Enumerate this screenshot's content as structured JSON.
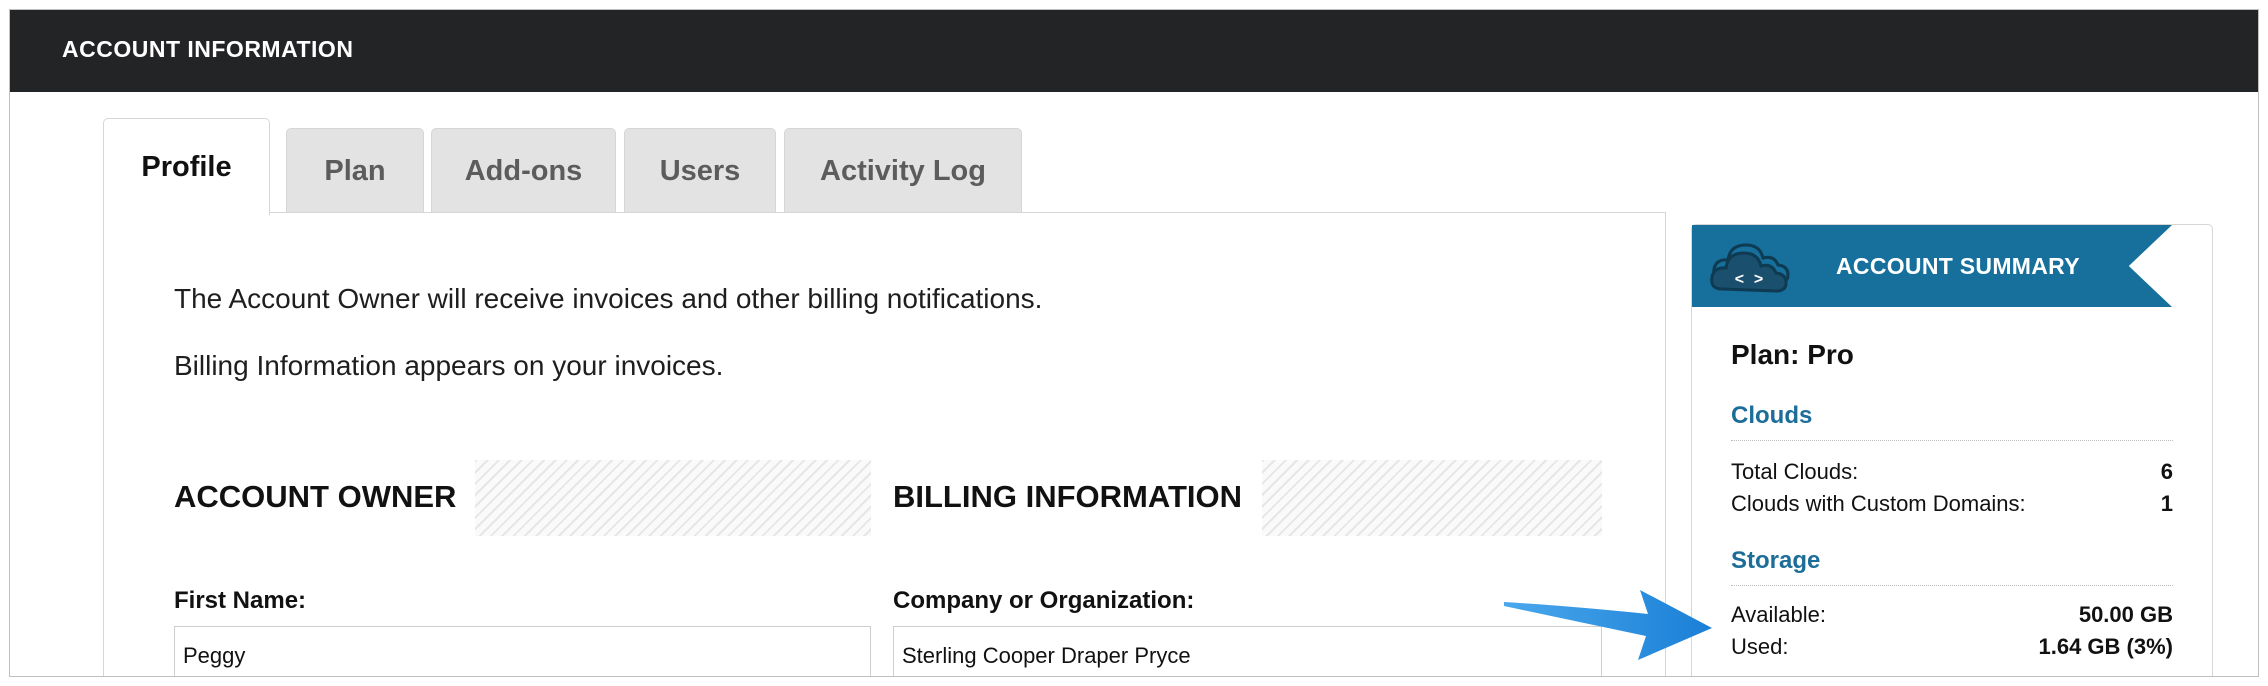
{
  "header": {
    "title": "ACCOUNT INFORMATION"
  },
  "tabs": [
    {
      "label": "Profile",
      "active": true
    },
    {
      "label": "Plan"
    },
    {
      "label": "Add-ons"
    },
    {
      "label": "Users"
    },
    {
      "label": "Activity Log"
    }
  ],
  "profile": {
    "intro_line1": "The Account Owner will receive invoices and other billing notifications.",
    "intro_line2": "Billing Information appears on your invoices.",
    "owner_section": "ACCOUNT OWNER",
    "billing_section": "BILLING INFORMATION",
    "first_name_label": "First Name:",
    "first_name_value": "Peggy",
    "company_label": "Company or Organization:",
    "company_value": "Sterling Cooper Draper Pryce"
  },
  "summary": {
    "title": "ACCOUNT SUMMARY",
    "icon": "cloud-code-icon",
    "plan": "Plan: Pro",
    "clouds_heading": "Clouds",
    "total_clouds_label": "Total Clouds:",
    "total_clouds_value": "6",
    "custom_domains_label": "Clouds with Custom Domains:",
    "custom_domains_value": "1",
    "storage_heading": "Storage",
    "available_label": "Available:",
    "available_value": "50.00 GB",
    "used_label": "Used:",
    "used_value": "1.64 GB (3%)"
  },
  "colors": {
    "header_bg": "#232426",
    "accent": "#176f9b",
    "annotation_arrow": "#1f8fe0"
  }
}
